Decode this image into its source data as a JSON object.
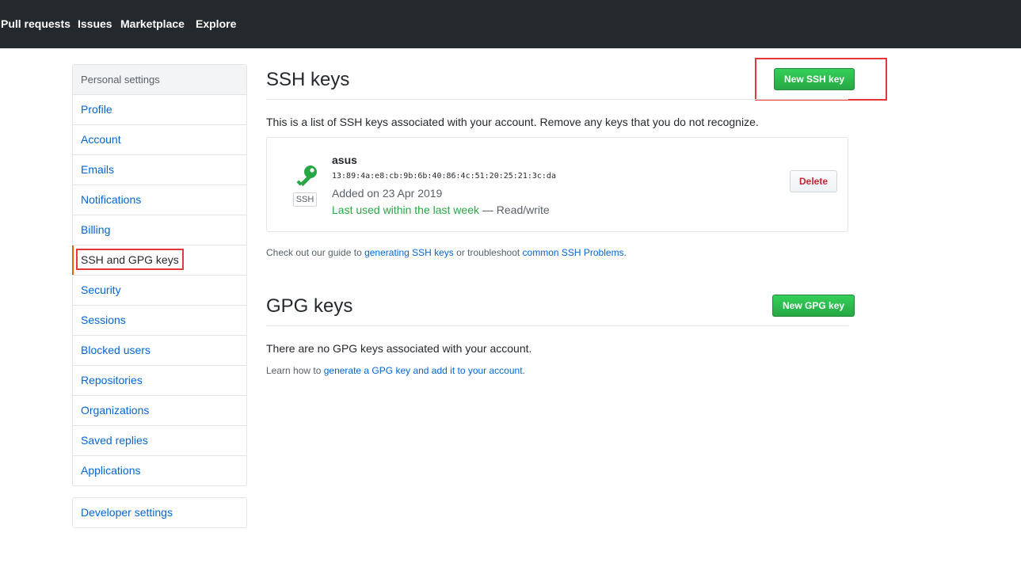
{
  "topnav": {
    "items": [
      "Pull requests",
      "Issues",
      "Marketplace",
      "Explore"
    ]
  },
  "sidebar": {
    "heading": "Personal settings",
    "items": [
      {
        "label": "Profile"
      },
      {
        "label": "Account"
      },
      {
        "label": "Emails"
      },
      {
        "label": "Notifications"
      },
      {
        "label": "Billing"
      },
      {
        "label": "SSH and GPG keys",
        "selected": true
      },
      {
        "label": "Security"
      },
      {
        "label": "Sessions"
      },
      {
        "label": "Blocked users"
      },
      {
        "label": "Repositories"
      },
      {
        "label": "Organizations"
      },
      {
        "label": "Saved replies"
      },
      {
        "label": "Applications"
      }
    ],
    "developer_settings": "Developer settings"
  },
  "ssh": {
    "title": "SSH keys",
    "new_button": "New SSH key",
    "description": "This is a list of SSH keys associated with your account. Remove any keys that you do not recognize.",
    "key": {
      "icon": "key-icon",
      "badge": "SSH",
      "title": "asus",
      "fingerprint": "13:89:4a:e8:cb:9b:6b:40:86:4c:51:20:25:21:3c:da",
      "added": "Added on 23 Apr 2019",
      "last_used": "Last used within the last week",
      "access": " — Read/write",
      "delete_label": "Delete"
    },
    "guide": {
      "prefix": "Check out our guide to ",
      "link1": "generating SSH keys",
      "middle": " or troubleshoot ",
      "link2": "common SSH Problems",
      "suffix": "."
    }
  },
  "gpg": {
    "title": "GPG keys",
    "new_button": "New GPG key",
    "empty_text": "There are no GPG keys associated with your account.",
    "learn": {
      "prefix": "Learn how to ",
      "link": "generate a GPG key and add it to your account",
      "suffix": "."
    }
  },
  "colors": {
    "accent_green": "#28a745",
    "link_blue": "#0366d6",
    "selected_marker": "#e36209",
    "highlight_red": "#e5383b",
    "topbar": "#24292e"
  }
}
